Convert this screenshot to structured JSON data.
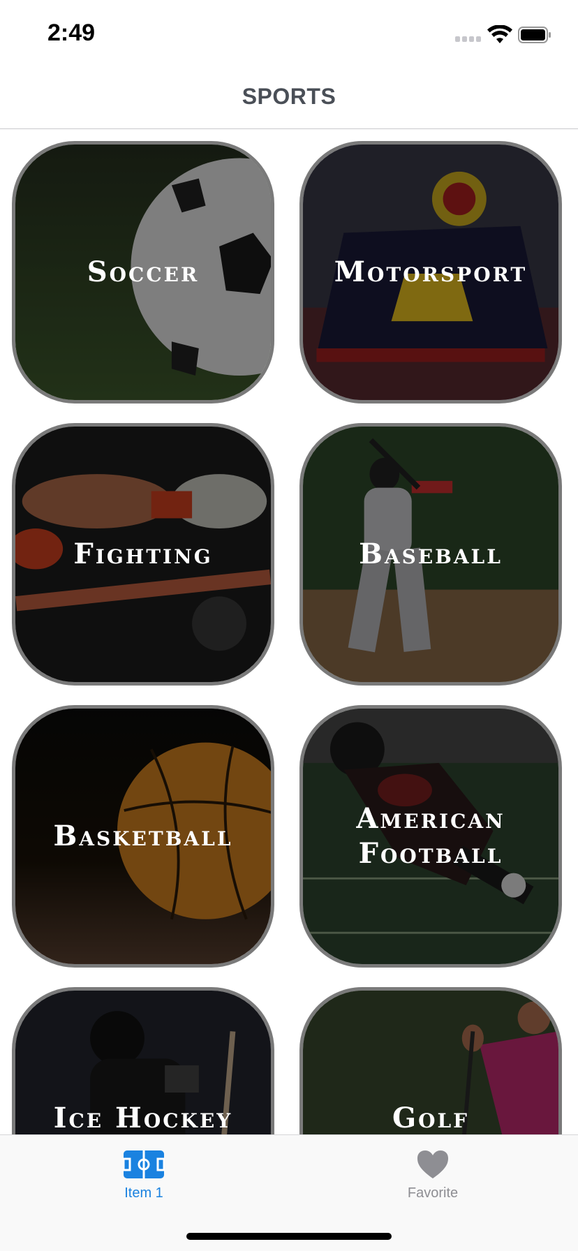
{
  "status_bar": {
    "time": "2:49"
  },
  "nav": {
    "title": "SPORTS"
  },
  "tiles": [
    {
      "label": "Soccer",
      "icon": "soccer-ball-image"
    },
    {
      "label": "Motorsport",
      "icon": "race-car-image"
    },
    {
      "label": "Fighting",
      "icon": "boxing-gloves-image"
    },
    {
      "label": "Baseball",
      "icon": "baseball-batter-image"
    },
    {
      "label": "Basketball",
      "icon": "basketball-image"
    },
    {
      "label": "American Football",
      "icon": "football-player-image"
    },
    {
      "label": "Ice Hockey",
      "icon": "hockey-player-image"
    },
    {
      "label": "Golf",
      "icon": "golfer-image"
    }
  ],
  "tab_bar": {
    "items": [
      {
        "label": "Item 1",
        "icon": "field-icon",
        "selected": true,
        "color": "#1a82e0"
      },
      {
        "label": "Favorite",
        "icon": "heart-icon",
        "selected": false,
        "color": "#8e8e93"
      }
    ]
  },
  "colors": {
    "accent": "#1a82e0",
    "tile_border": "#7a7a7a",
    "nav_title": "#4a4f57"
  }
}
